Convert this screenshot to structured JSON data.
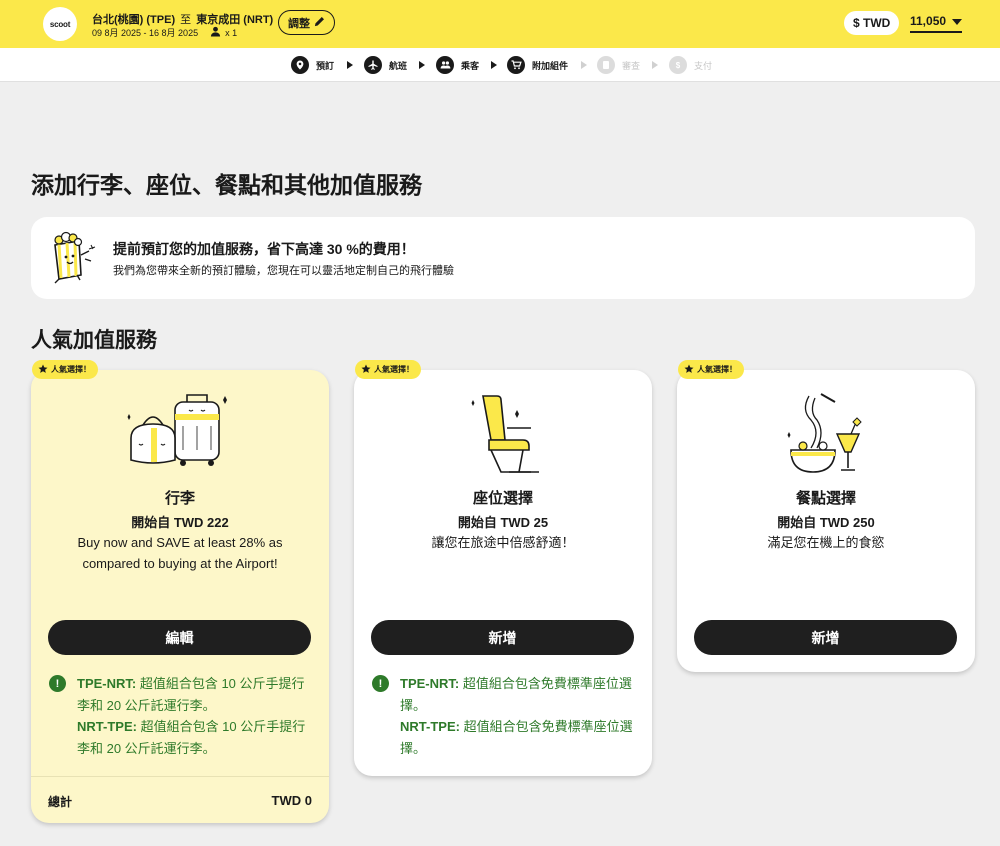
{
  "header": {
    "logo": "scoot",
    "origin": "台北(桃園) (TPE)",
    "to": "至",
    "destination": "東京成田 (NRT)",
    "dates": "09 8月 2025 - 16 8月 2025",
    "pax_icon": "person-icon",
    "passengers": "x 1",
    "adjust_label": "調整",
    "currency_label": "$ TWD",
    "total": "11,050"
  },
  "steps": [
    {
      "label": "預訂",
      "icon": "location-pin-icon",
      "state": "done"
    },
    {
      "label": "航班",
      "icon": "plane-icon",
      "state": "done"
    },
    {
      "label": "乘客",
      "icon": "people-icon",
      "state": "done"
    },
    {
      "label": "附加組件",
      "icon": "cart-icon",
      "state": "current"
    },
    {
      "label": "審查",
      "icon": "document-icon",
      "state": "disabled"
    },
    {
      "label": "支付",
      "icon": "dollar-icon",
      "state": "disabled"
    }
  ],
  "page": {
    "title": "添加行李、座位、餐點和其他加值服務",
    "promo_title": "提前預訂您的加值服務，省下高達 30 %的費用！",
    "promo_subtitle": "我們為您帶來全新的預訂體驗，您現在可以靈活地定制自己的飛行體驗",
    "section_title": "人氣加值服務"
  },
  "cards": [
    {
      "badge": "人氣選擇！",
      "name": "行李",
      "price": "開始自 TWD 222",
      "description": "Buy now and SAVE at least 28% as compared to buying at the Airport!",
      "button": "編輯",
      "info_route_1": "TPE-NRT:",
      "info_text_1": " 超值組合包含 10 公斤手提行李和 20 公斤託運行李。",
      "info_route_2": "NRT-TPE:",
      "info_text_2": " 超值組合包含 10 公斤手提行李和 20 公斤託運行李。",
      "total_label": "總計",
      "total_value": "TWD 0"
    },
    {
      "badge": "人氣選擇！",
      "name": "座位選擇",
      "price": "開始自 TWD 25",
      "description": "讓您在旅途中倍感舒適！",
      "button": "新增",
      "info_route_1": "TPE-NRT:",
      "info_text_1": " 超值組合包含免費標準座位選擇。",
      "info_route_2": "NRT-TPE:",
      "info_text_2": " 超值組合包含免費標準座位選擇。"
    },
    {
      "badge": "人氣選擇！",
      "name": "餐點選擇",
      "price": "開始自 TWD 250",
      "description": "滿足您在機上的食慾",
      "button": "新增"
    }
  ],
  "colors": {
    "brand_yellow": "#fbe84a",
    "selected_card": "#fdf7c9",
    "info_green": "#2e7a2a",
    "dark": "#1f1f1f"
  }
}
